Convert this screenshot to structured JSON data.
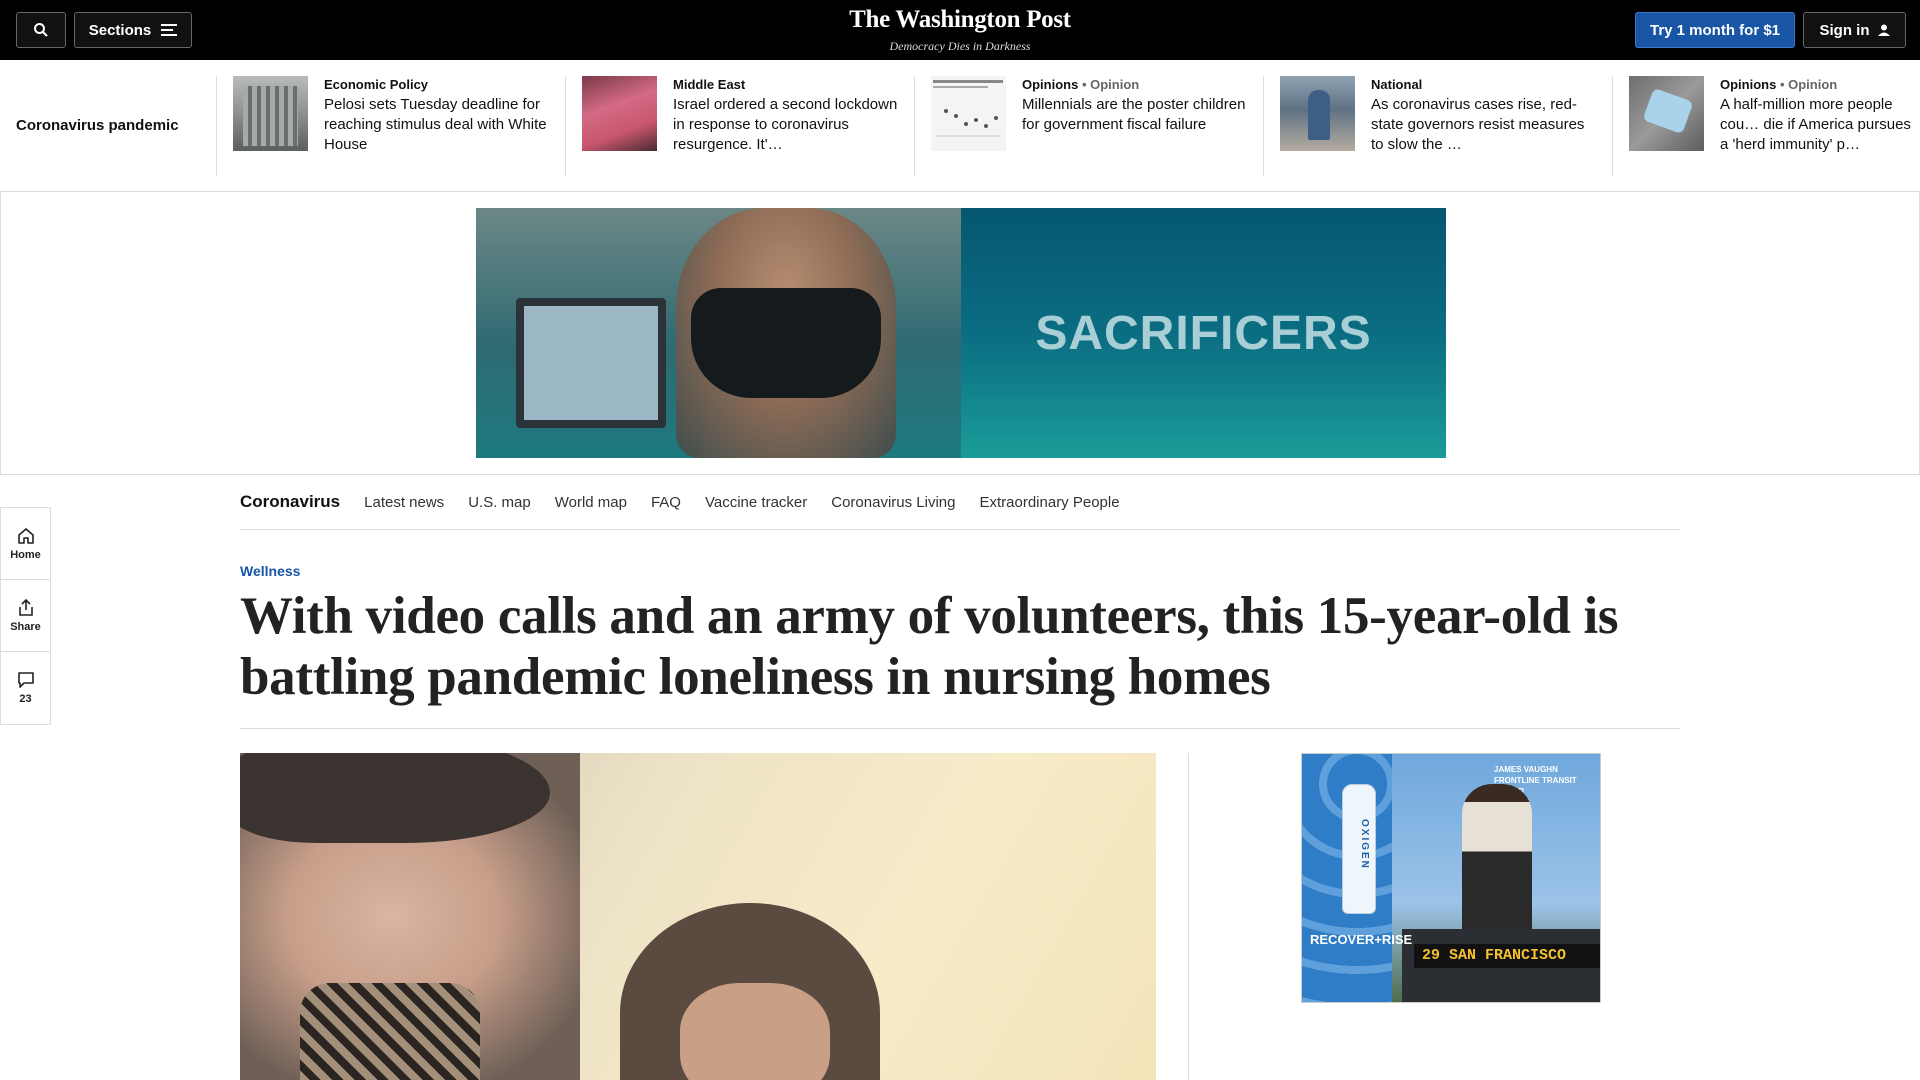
{
  "header": {
    "sections_label": "Sections",
    "logo": "The Washington Post",
    "tagline": "Democracy Dies in Darkness",
    "subscribe_label": "Try 1 month for $1",
    "signin_label": "Sign in"
  },
  "strip": {
    "title": "Coronavirus pandemic",
    "items": [
      {
        "kicker": "Economic Policy",
        "opinion": "",
        "headline": "Pelosi sets Tuesday deadline for reaching stimulus deal with White House"
      },
      {
        "kicker": "Middle East",
        "opinion": "",
        "headline": "Israel ordered a second lockdown in response to coronavirus resurgence. It'…"
      },
      {
        "kicker": "Opinions",
        "opinion": "• Opinion",
        "headline": "Millennials are the poster children for government fiscal failure"
      },
      {
        "kicker": "National",
        "opinion": "",
        "headline": "As coronavirus cases rise, red-state governors resist measures to slow the …"
      },
      {
        "kicker": "Opinions",
        "opinion": "• Opinion",
        "headline": "A half-million more people cou… die if America pursues a 'herd immunity' p…"
      }
    ]
  },
  "ad_banner": {
    "word": "SACRIFICERS"
  },
  "section_nav": {
    "main": "Coronavirus",
    "links": [
      "Latest news",
      "U.S. map",
      "World map",
      "FAQ",
      "Vaccine tracker",
      "Coronavirus Living",
      "Extraordinary People"
    ]
  },
  "rail": {
    "home": "Home",
    "share": "Share",
    "comments": "23"
  },
  "article": {
    "kicker": "Wellness",
    "headline": "With video calls and an army of volunteers, this 15-year-old is battling pandemic loneliness in nursing homes"
  },
  "side_ad": {
    "brand": "OXIGEN",
    "tagline": "RECOVER+RISE",
    "person_name": "JAMES VAUGHN",
    "person_title": "FRONTLINE TRANSIT DRIVER",
    "bus_sign": "29  SAN FRANCISCO"
  },
  "colors": {
    "accent": "#1955a5",
    "topbar": "#000000"
  },
  "icons": [
    "search-icon",
    "menu-icon",
    "user-icon",
    "home-icon",
    "share-icon",
    "comment-icon"
  ]
}
